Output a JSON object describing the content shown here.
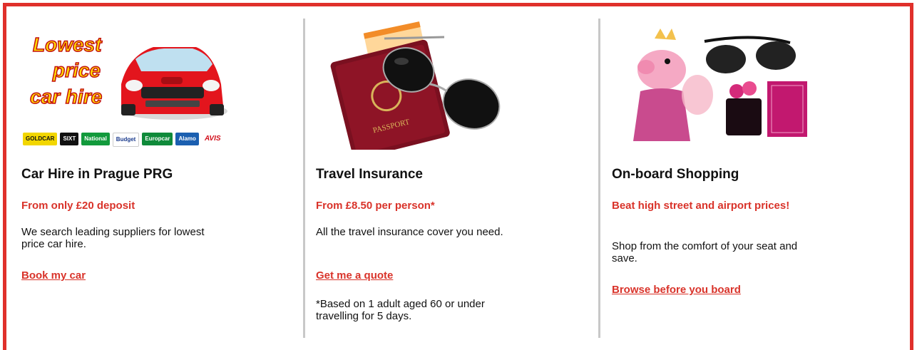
{
  "colors": {
    "accent": "#e0302b",
    "link": "#d9332a",
    "divider": "#c8c8c8"
  },
  "cards": [
    {
      "image_text": [
        "Lowest",
        "price",
        "car hire"
      ],
      "image_logos": [
        "GOLDCAR",
        "SIXT",
        "National",
        "Budget",
        "Europcar",
        "Alamo",
        "AVIS"
      ],
      "title": "Car Hire in Prague PRG",
      "price": "From only £20 deposit",
      "description": "We search leading suppliers for lowest price car hire.",
      "link": "Book my car"
    },
    {
      "image_text": [
        "PASSPORT"
      ],
      "title": "Travel Insurance",
      "price": "From £8.50 per person*",
      "description": "All the travel insurance cover you need.",
      "link": "Get me a quote",
      "note": "*Based on 1 adult aged 60 or under travelling for 5 days."
    },
    {
      "title": "On-board Shopping",
      "price": "Beat high street and airport prices!",
      "description": "Shop from the comfort of your seat and save.",
      "link": "Browse before you board"
    }
  ]
}
